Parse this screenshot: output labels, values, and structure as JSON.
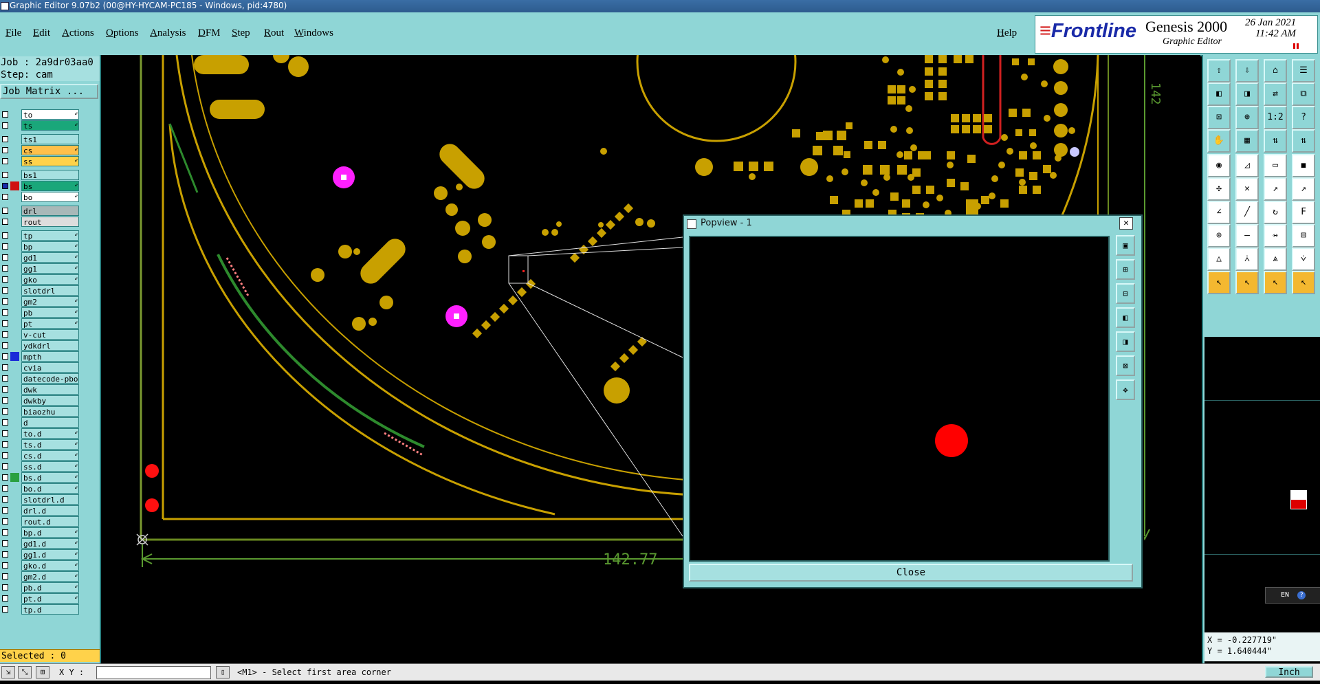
{
  "titlebar": {
    "title": "Graphic Editor 9.07b2 (00@HY-HYCAM-PC185 - Windows, pid:4780)"
  },
  "menu": {
    "items": [
      "File",
      "Edit",
      "Actions",
      "Options",
      "Analysis",
      "DFM",
      "Step",
      "Rout",
      "Windows"
    ],
    "help": "Help"
  },
  "brand": {
    "logo": "Frontline",
    "product": "Genesis 2000",
    "subtitle": "Graphic Editor",
    "date": "26 Jan 2021",
    "time": "11:42 AM"
  },
  "job": {
    "job_label": "Job : 2a9dr03aa0",
    "step_label": "Step: cam",
    "job_matrix_button": "Job Matrix ..."
  },
  "layers": [
    {
      "name": "to",
      "color": "#ffffff",
      "arrow": "⇙"
    },
    {
      "name": "ts",
      "color": "#1aa77a",
      "arrow": "⇙"
    },
    {
      "name": "ts1",
      "color": "",
      "arrow": ""
    },
    {
      "name": "cs",
      "color": "#ffc04a",
      "arrow": "⇙"
    },
    {
      "name": "ss",
      "color": "#ffd24a",
      "arrow": "⇙"
    },
    {
      "name": "bs1",
      "color": "",
      "arrow": ""
    },
    {
      "name": "bs",
      "color": "#1aa77a",
      "arrow": "⇙"
    },
    {
      "name": "bo",
      "color": "#ffffff",
      "arrow": "⇙"
    },
    {
      "name": "drl",
      "color": "#a8b8b8",
      "arrow": ""
    },
    {
      "name": "rout",
      "color": "#dddddd",
      "arrow": ""
    },
    {
      "name": "tp",
      "color": "",
      "arrow": "⇙"
    },
    {
      "name": "bp",
      "color": "",
      "arrow": "⇙"
    },
    {
      "name": "gd1",
      "color": "",
      "arrow": "⇙"
    },
    {
      "name": "gg1",
      "color": "",
      "arrow": "⇙"
    },
    {
      "name": "gko",
      "color": "",
      "arrow": "⇙"
    },
    {
      "name": "slotdrl",
      "color": "",
      "arrow": ""
    },
    {
      "name": "gm2",
      "color": "",
      "arrow": "⇙"
    },
    {
      "name": "pb",
      "color": "",
      "arrow": "⇙"
    },
    {
      "name": "pt",
      "color": "",
      "arrow": "⇙"
    },
    {
      "name": "v-cut",
      "color": "",
      "arrow": ""
    },
    {
      "name": "ydkdrl",
      "color": "",
      "arrow": ""
    },
    {
      "name": "mpth",
      "color": "",
      "arrow": ""
    },
    {
      "name": "cvia",
      "color": "",
      "arrow": ""
    },
    {
      "name": "datecode-pbo",
      "color": "",
      "arrow": ""
    },
    {
      "name": "dwk",
      "color": "",
      "arrow": ""
    },
    {
      "name": "dwkby",
      "color": "",
      "arrow": ""
    },
    {
      "name": "biaozhu",
      "color": "",
      "arrow": ""
    },
    {
      "name": "d",
      "color": "",
      "arrow": ""
    },
    {
      "name": "to.d",
      "color": "",
      "arrow": "⇙"
    },
    {
      "name": "ts.d",
      "color": "",
      "arrow": "⇙"
    },
    {
      "name": "cs.d",
      "color": "",
      "arrow": "⇙"
    },
    {
      "name": "ss.d",
      "color": "",
      "arrow": "⇙"
    },
    {
      "name": "bs.d",
      "color": "",
      "arrow": "⇙"
    },
    {
      "name": "bo.d",
      "color": "",
      "arrow": "⇙"
    },
    {
      "name": "slotdrl.d",
      "color": "",
      "arrow": ""
    },
    {
      "name": "drl.d",
      "color": "",
      "arrow": ""
    },
    {
      "name": "rout.d",
      "color": "",
      "arrow": ""
    },
    {
      "name": "bp.d",
      "color": "",
      "arrow": "⇙"
    },
    {
      "name": "gd1.d",
      "color": "",
      "arrow": "⇙"
    },
    {
      "name": "gg1.d",
      "color": "",
      "arrow": "⇙"
    },
    {
      "name": "gko.d",
      "color": "",
      "arrow": "⇙"
    },
    {
      "name": "gm2.d",
      "color": "",
      "arrow": "⇙"
    },
    {
      "name": "pb.d",
      "color": "",
      "arrow": "⇙"
    },
    {
      "name": "pt.d",
      "color": "",
      "arrow": "⇙"
    },
    {
      "name": "tp.d",
      "color": "",
      "arrow": ""
    }
  ],
  "selected": "Selected : 0",
  "canvas": {
    "dimension_horizontal": "142.77",
    "dimension_vertical": "142"
  },
  "popview": {
    "title": "Popview - 1",
    "close_label": "Close"
  },
  "coords": {
    "x": "X = -0.227719\"",
    "y": "Y = 1.640444\""
  },
  "statusbar": {
    "xy_label": "X Y :",
    "message": "<M1> - Select first area corner",
    "units": "Inch"
  },
  "tray": {
    "lang": "EN"
  },
  "colors": {
    "panel": "#8fd6d6",
    "pad": "#c8a000",
    "accent": "#1aa77a"
  }
}
